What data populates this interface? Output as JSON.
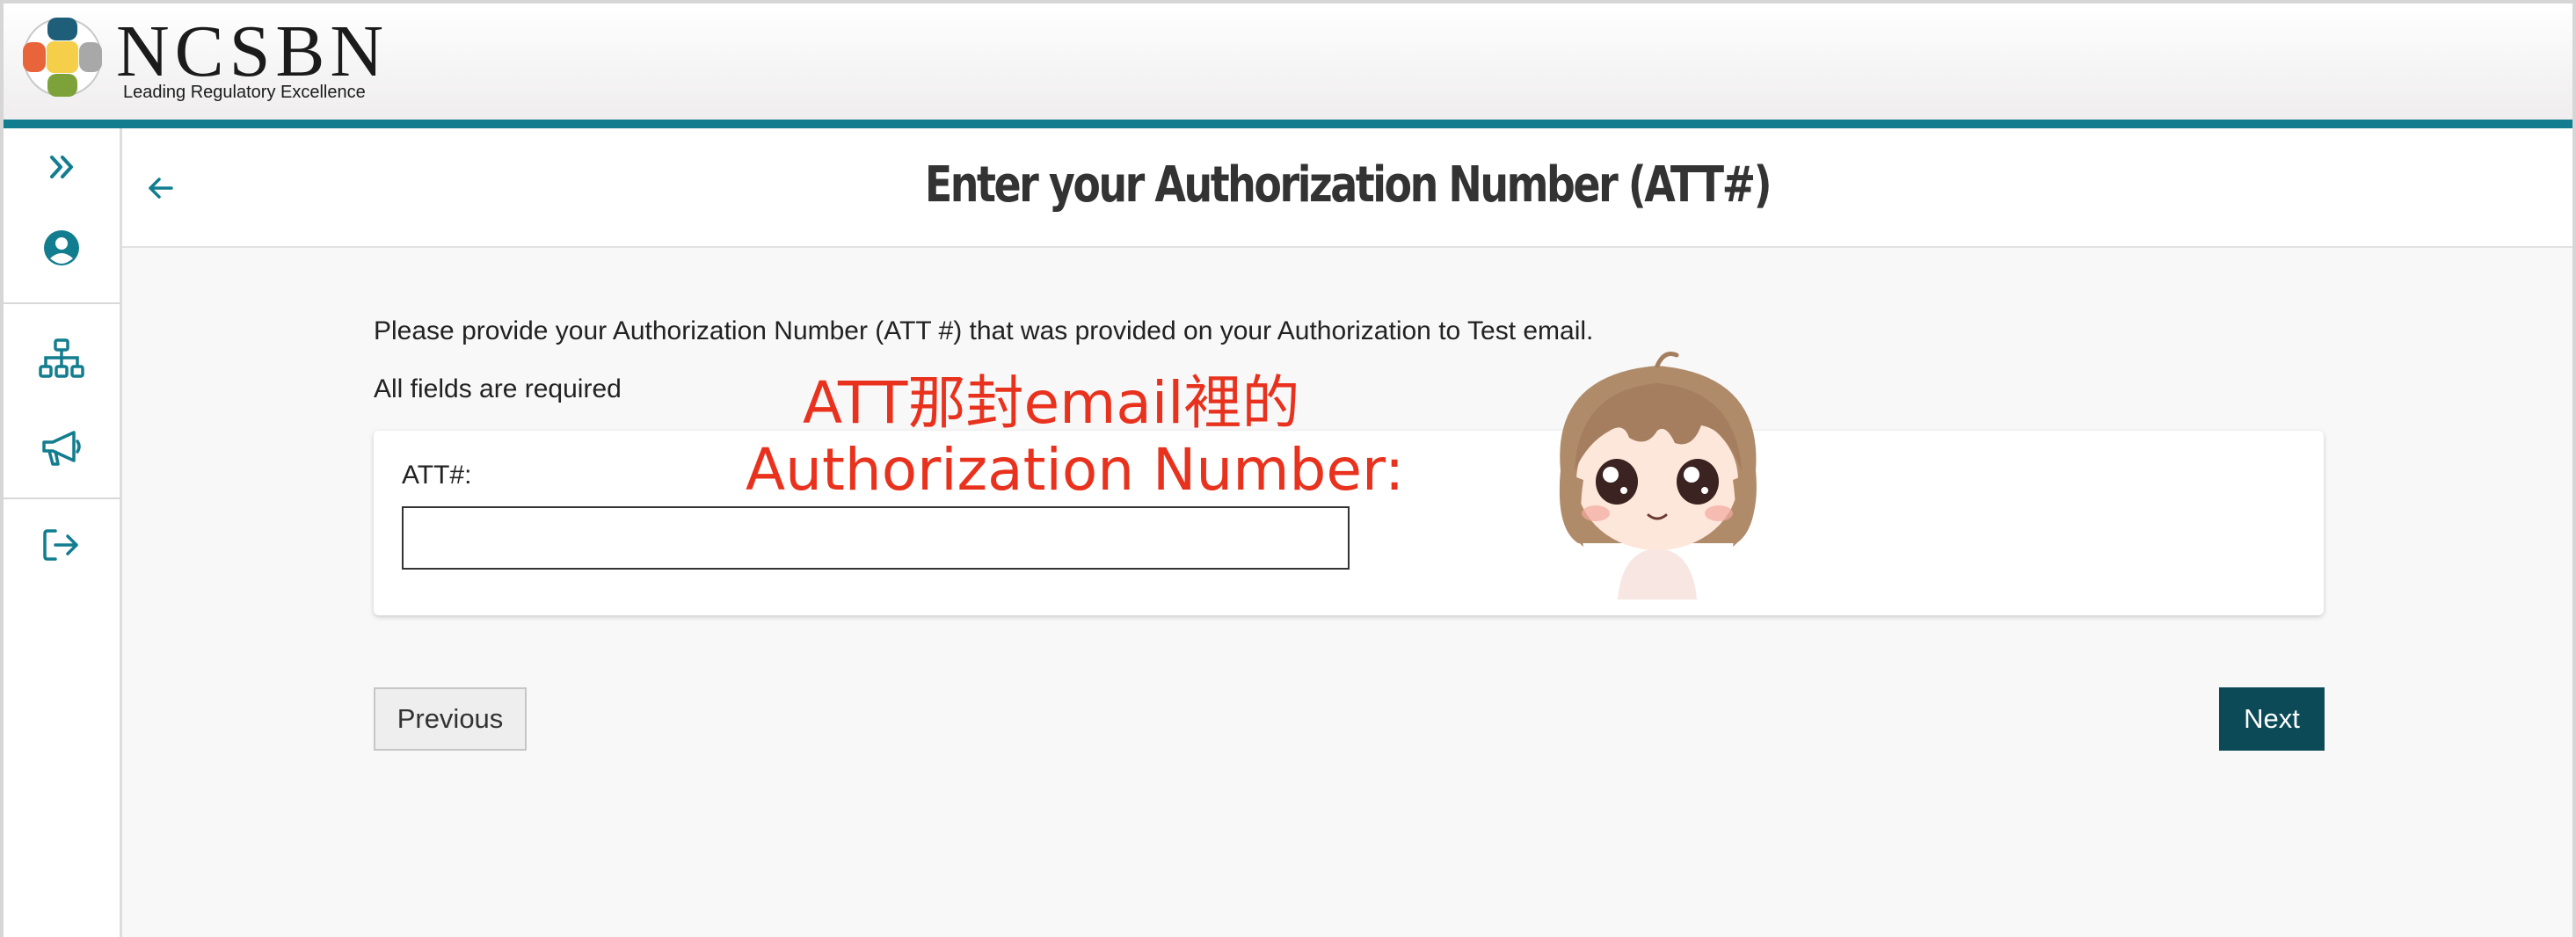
{
  "header": {
    "brand": "NCSBN",
    "tagline": "Leading Regulatory Excellence",
    "accent_color": "#127d8f"
  },
  "sidebar": {
    "items": [
      {
        "icon": "double-chevron-right-icon"
      },
      {
        "icon": "user-circle-icon"
      },
      {
        "icon": "sitemap-icon"
      },
      {
        "icon": "megaphone-icon"
      },
      {
        "icon": "sign-out-icon"
      }
    ]
  },
  "page": {
    "title": "Enter your Authorization Number (ATT#)",
    "back_icon": "arrow-left-icon"
  },
  "form": {
    "intro": "Please provide your Authorization Number (ATT #) that was provided on your Authorization to Test email.",
    "required_note": "All fields are required",
    "att_label": "ATT#:",
    "att_value": ""
  },
  "buttons": {
    "previous": "Previous",
    "next": "Next",
    "next_color": "#0c4a58"
  },
  "annotation": {
    "line1": "ATT那封email裡的",
    "line2": "Authorization Number:",
    "color": "#e8321e",
    "sticker": "chibi-girl-sticker"
  }
}
